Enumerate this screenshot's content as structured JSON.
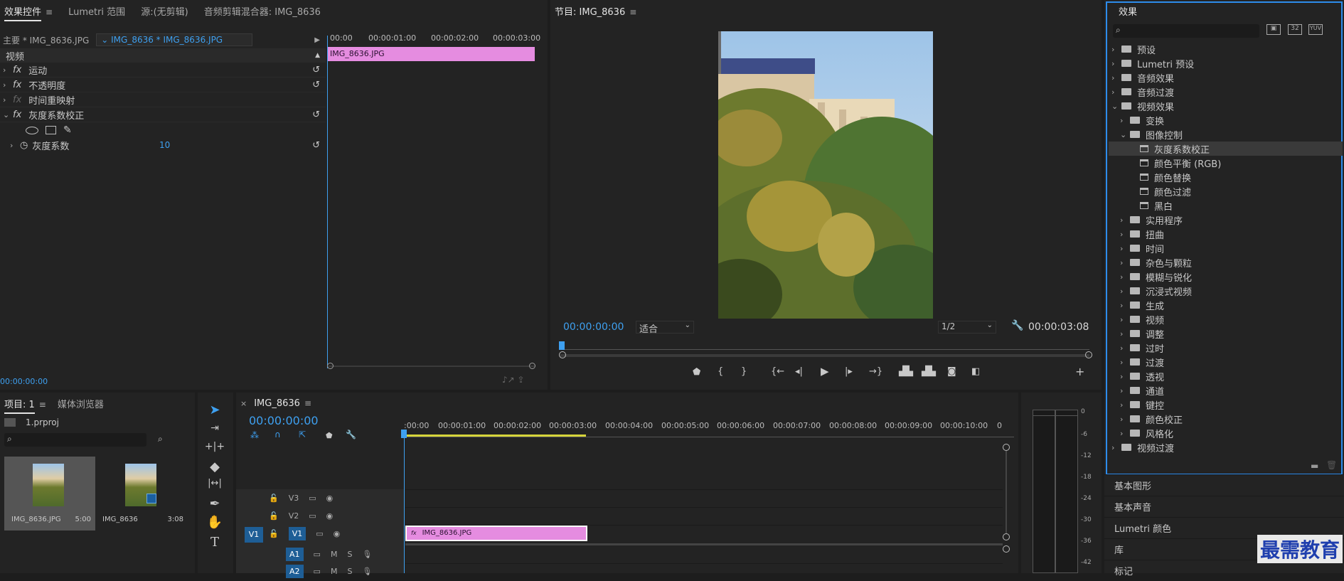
{
  "effect_controls": {
    "tabs": [
      "效果控件",
      "Lumetri 范围",
      "源:(无剪辑)",
      "音频剪辑混合器: IMG_8636"
    ],
    "master_label": "主要 * IMG_8636.JPG",
    "clip_selector": "IMG_8636 * IMG_8636.JPG",
    "video_header": "视频",
    "effects": [
      "运动",
      "不透明度",
      "时间重映射",
      "灰度系数校正"
    ],
    "gamma_label": "灰度系数",
    "gamma_value": "10",
    "ruler": [
      "00:00",
      "00:00:01:00",
      "00:00:02:00",
      "00:00:03:00"
    ],
    "clip_name": "IMG_8636.JPG",
    "timecode": "00:00:00:00"
  },
  "program": {
    "title": "节目: IMG_8636",
    "timecode_current": "00:00:00:00",
    "fit_option": "适合",
    "resolution_option": "1/2",
    "timecode_duration": "00:00:03:08"
  },
  "effects_panel": {
    "title": "效果",
    "search_placeholder": "",
    "top_items": [
      "预设",
      "Lumetri 预设",
      "音频效果",
      "音频过渡",
      "视频效果"
    ],
    "video_effects_children": [
      "变换",
      "图像控制"
    ],
    "image_control_children": [
      "灰度系数校正",
      "颜色平衡 (RGB)",
      "颜色替换",
      "颜色过滤",
      "黑白"
    ],
    "more_folders": [
      "实用程序",
      "扭曲",
      "时间",
      "杂色与颗粒",
      "模糊与锐化",
      "沉浸式视频",
      "生成",
      "视频",
      "调整",
      "过时",
      "过渡",
      "透视",
      "通道",
      "键控",
      "颜色校正",
      "风格化"
    ],
    "last_item": "视频过渡",
    "bottom_tabs": [
      "基本图形",
      "基本声音",
      "Lumetri 颜色",
      "库",
      "标记"
    ]
  },
  "project": {
    "tabs": [
      "项目: 1",
      "媒体浏览器"
    ],
    "file_name": "1.prproj",
    "items": [
      {
        "name": "IMG_8636.JPG",
        "duration": "5:00"
      },
      {
        "name": "IMG_8636",
        "duration": "3:08"
      }
    ]
  },
  "timeline": {
    "title": "IMG_8636",
    "timecode": "00:00:00:00",
    "ruler": [
      ":00:00",
      "00:00:01:00",
      "00:00:02:00",
      "00:00:03:00",
      "00:00:04:00",
      "00:00:05:00",
      "00:00:06:00",
      "00:00:07:00",
      "00:00:08:00",
      "00:00:09:00",
      "00:00:10:00",
      "0"
    ],
    "video_tracks": [
      "V3",
      "V2",
      "V1"
    ],
    "audio_tracks": [
      "A1",
      "A2"
    ],
    "source_patch": "V1",
    "clip_name": "IMG_8636.JPG",
    "mute_label": "M",
    "solo_label": "S"
  },
  "meter": {
    "scale": [
      "0",
      "-6",
      "-12",
      "-18",
      "-24",
      "-30",
      "-36",
      "-42"
    ]
  },
  "watermark": "最需教育",
  "colors": {
    "accent": "#3ea0f0",
    "clip": "#e58ce0",
    "active_panel": "#2d8ceb"
  }
}
